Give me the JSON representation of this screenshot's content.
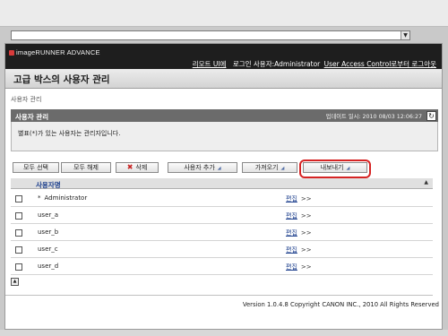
{
  "header": {
    "logo_text": "imageRUNNER ADVANCE",
    "links": {
      "remote_ui": "리모트 UI에",
      "login_user": "로그인 사용자:Administrator",
      "logout": "User Access Control로부터 로그아웃"
    }
  },
  "page_title": "고급 박스의 사용자 관리",
  "breadcrumb": "사용자 관리",
  "panel": {
    "title": "사용자 관리",
    "last_update": "업데이트 일시: 2010 08/03 12:06:27",
    "note": "별표(*)가 있는 사용자는 관리자입니다."
  },
  "toolbar": {
    "select_all": "모두 선택",
    "clear_all": "모두 해제",
    "delete": "삭제",
    "add_user": "사용자 추가",
    "import": "가져오기",
    "export": "내보내기"
  },
  "table": {
    "column_username": "사용자명",
    "edit_label": "편집",
    "edit_arrow": ">>",
    "rows": [
      {
        "name": "Administrator",
        "is_admin": true,
        "mark": "*"
      },
      {
        "name": "user_a",
        "is_admin": false
      },
      {
        "name": "user_b",
        "is_admin": false
      },
      {
        "name": "user_c",
        "is_admin": false
      },
      {
        "name": "user_d",
        "is_admin": false
      }
    ]
  },
  "footer": {
    "copyright": "Version 1.0.4.8 Copyright CANON INC., 2010 All Rights Reserved"
  },
  "colors": {
    "header_bg": "#1e1e1e",
    "panel_header_bg": "#6b6b6b",
    "link_blue": "#1b3e8c",
    "highlight_red": "#d62424",
    "delete_red": "#c62020"
  },
  "icons": [
    "dropdown-arrow-icon",
    "canon-logo-icon",
    "refresh-icon",
    "delete-x-icon",
    "sort-ascending-icon",
    "scroll-top-icon"
  ]
}
